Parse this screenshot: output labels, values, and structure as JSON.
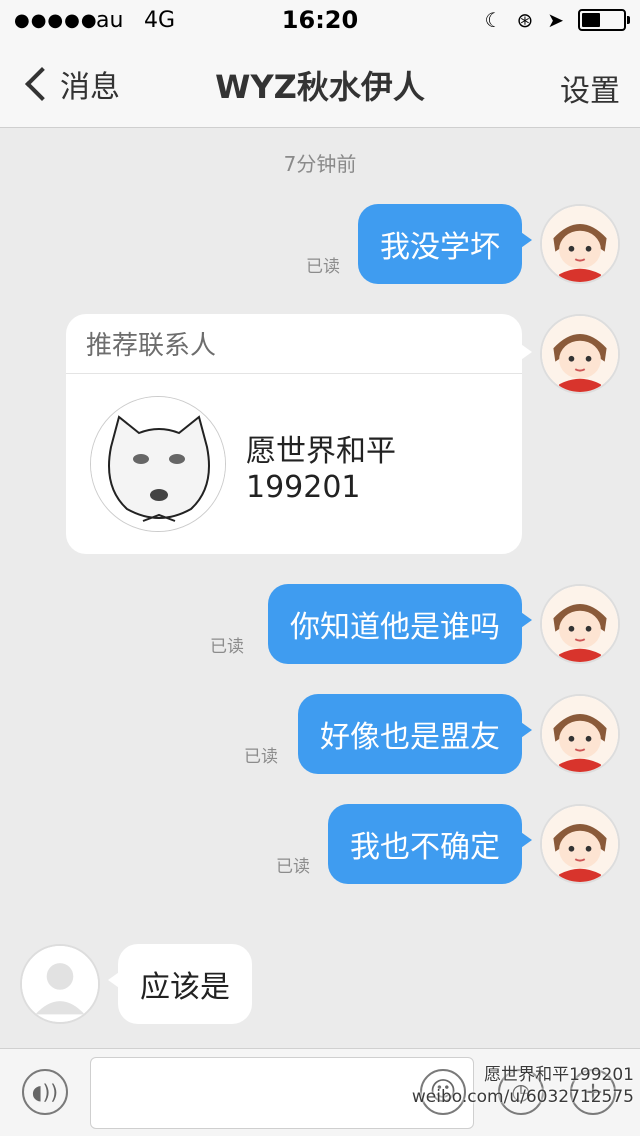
{
  "status_bar": {
    "signal": "●●●●●",
    "carrier": "au",
    "network": "4G",
    "time": "16:20",
    "battery_level": 0.45
  },
  "nav": {
    "back_label": "消息",
    "title": "WYZ秋水伊人",
    "settings_label": "设置"
  },
  "chat": {
    "timestamp": "7分钟前",
    "read_label": "已读",
    "outgoing": [
      {
        "text": "我没学坏"
      },
      {
        "text": "你知道他是谁吗"
      },
      {
        "text": "好像也是盟友"
      },
      {
        "text": "我也不确定"
      }
    ],
    "contact_card": {
      "header": "推荐联系人",
      "name": "愿世界和平",
      "id": "199201"
    },
    "incoming": [
      {
        "text": "应该是"
      }
    ]
  },
  "input": {
    "placeholder": "",
    "plus": "+"
  },
  "watermark": {
    "line1": "愿世界和平199201",
    "line2": "weibo.com/u/6032712575"
  },
  "colors": {
    "bubble_out": "#3f9cf0",
    "background": "#ebebeb"
  }
}
